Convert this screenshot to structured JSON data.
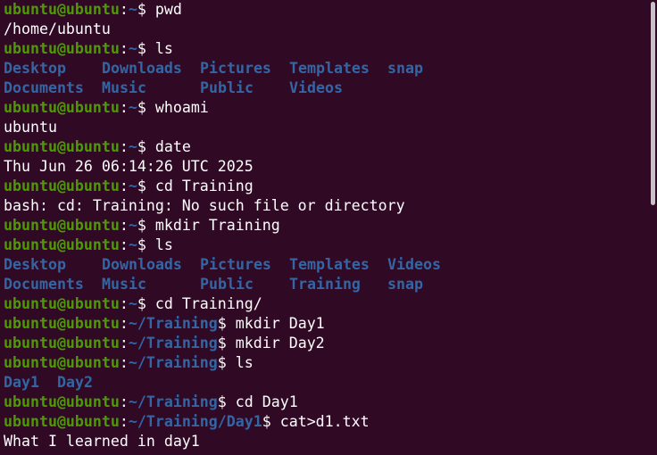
{
  "terminal": {
    "colors": {
      "background": "#300a24",
      "user": "#4e9a06",
      "path": "#3465a4",
      "text": "#ffffff"
    },
    "lines": [
      {
        "type": "prompt",
        "user": "ubuntu@ubuntu",
        "colon": ":",
        "path": "~",
        "symbol": "$ ",
        "command": "pwd"
      },
      {
        "type": "output",
        "text": "/home/ubuntu"
      },
      {
        "type": "prompt",
        "user": "ubuntu@ubuntu",
        "colon": ":",
        "path": "~",
        "symbol": "$ ",
        "command": "ls"
      },
      {
        "type": "dirs",
        "items": [
          "Desktop",
          "Downloads",
          "Pictures",
          "Templates",
          "snap"
        ]
      },
      {
        "type": "dirs",
        "items": [
          "Documents",
          "Music",
          "Public",
          "Videos"
        ]
      },
      {
        "type": "prompt",
        "user": "ubuntu@ubuntu",
        "colon": ":",
        "path": "~",
        "symbol": "$ ",
        "command": "whoami"
      },
      {
        "type": "output",
        "text": "ubuntu"
      },
      {
        "type": "prompt",
        "user": "ubuntu@ubuntu",
        "colon": ":",
        "path": "~",
        "symbol": "$ ",
        "command": "date"
      },
      {
        "type": "output",
        "text": "Thu Jun 26 06:14:26 UTC 2025"
      },
      {
        "type": "prompt",
        "user": "ubuntu@ubuntu",
        "colon": ":",
        "path": "~",
        "symbol": "$ ",
        "command": "cd Training"
      },
      {
        "type": "output",
        "text": "bash: cd: Training: No such file or directory"
      },
      {
        "type": "prompt",
        "user": "ubuntu@ubuntu",
        "colon": ":",
        "path": "~",
        "symbol": "$ ",
        "command": "mkdir Training"
      },
      {
        "type": "prompt",
        "user": "ubuntu@ubuntu",
        "colon": ":",
        "path": "~",
        "symbol": "$ ",
        "command": "ls"
      },
      {
        "type": "dirs",
        "items": [
          "Desktop",
          "Downloads",
          "Pictures",
          "Templates",
          "Videos"
        ]
      },
      {
        "type": "dirs",
        "items": [
          "Documents",
          "Music",
          "Public",
          "Training",
          "snap"
        ]
      },
      {
        "type": "prompt",
        "user": "ubuntu@ubuntu",
        "colon": ":",
        "path": "~",
        "symbol": "$ ",
        "command": "cd Training/"
      },
      {
        "type": "prompt",
        "user": "ubuntu@ubuntu",
        "colon": ":",
        "path": "~/Training",
        "symbol": "$ ",
        "command": "mkdir Day1"
      },
      {
        "type": "prompt",
        "user": "ubuntu@ubuntu",
        "colon": ":",
        "path": "~/Training",
        "symbol": "$ ",
        "command": "mkdir Day2"
      },
      {
        "type": "prompt",
        "user": "ubuntu@ubuntu",
        "colon": ":",
        "path": "~/Training",
        "symbol": "$ ",
        "command": "ls"
      },
      {
        "type": "dirs",
        "items": [
          "Day1",
          "Day2"
        ]
      },
      {
        "type": "prompt",
        "user": "ubuntu@ubuntu",
        "colon": ":",
        "path": "~/Training",
        "symbol": "$ ",
        "command": "cd Day1"
      },
      {
        "type": "prompt",
        "user": "ubuntu@ubuntu",
        "colon": ":",
        "path": "~/Training/Day1",
        "symbol": "$ ",
        "command": "cat>d1.txt"
      },
      {
        "type": "output",
        "text": "What I learned in day1"
      }
    ]
  }
}
